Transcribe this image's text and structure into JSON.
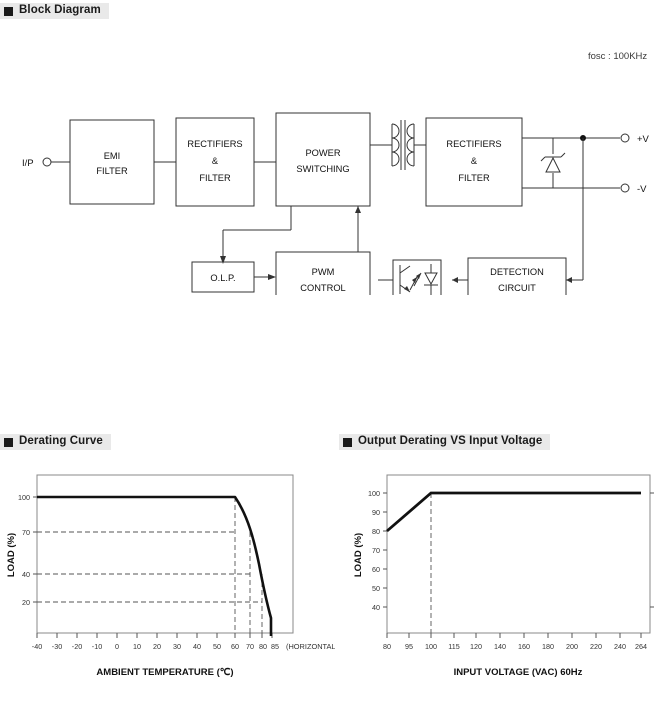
{
  "sections": {
    "block_diagram": {
      "title": "Block Diagram"
    },
    "derating_curve": {
      "title": "Derating Curve"
    },
    "output_derating": {
      "title": "Output Derating VS Input Voltage"
    }
  },
  "block_diagram": {
    "fosc_note": "fosc : 100KHz",
    "input_terminal": "I/P",
    "output_terminals": [
      "+V",
      "-V"
    ],
    "blocks": [
      {
        "id": "emi-filter",
        "lines": [
          "EMI",
          "FILTER"
        ]
      },
      {
        "id": "rectifiers-filter-primary",
        "lines": [
          "RECTIFIERS",
          "&",
          "FILTER"
        ]
      },
      {
        "id": "power-switching",
        "lines": [
          "POWER",
          "SWITCHING"
        ]
      },
      {
        "id": "rectifiers-filter-secondary",
        "lines": [
          "RECTIFIERS",
          "&",
          "FILTER"
        ]
      },
      {
        "id": "olp",
        "lines": [
          "O.L.P."
        ]
      },
      {
        "id": "pwm-control",
        "lines": [
          "PWM",
          "CONTROL"
        ]
      },
      {
        "id": "detection-circuit",
        "lines": [
          "DETECTION",
          "CIRCUIT"
        ]
      }
    ],
    "symbols": [
      "transformer",
      "optocoupler",
      "zener-diode"
    ]
  },
  "chart_data": [
    {
      "type": "line",
      "id": "derating-curve",
      "title": "Derating Curve",
      "xlabel": "AMBIENT TEMPERATURE (℃)",
      "ylabel": "LOAD (%)",
      "note": "(HORIZONTAL)",
      "x": [
        -40,
        60,
        70,
        80,
        85,
        85
      ],
      "values": [
        100,
        100,
        70,
        40,
        20,
        0
      ],
      "xticks": [
        -40,
        -30,
        -20,
        -10,
        0,
        10,
        20,
        30,
        40,
        50,
        60,
        70,
        80,
        85
      ],
      "xtick_labels": [
        "-40",
        "-30",
        "-20",
        "-10",
        "0",
        "10",
        "20",
        "30",
        "40",
        "50",
        "60",
        "70",
        "80",
        "85"
      ],
      "yticks": [
        20,
        40,
        70,
        100
      ],
      "ytick_labels": [
        "20",
        "40",
        "70",
        "100"
      ],
      "xlim": [
        -40,
        92
      ],
      "ylim": [
        0,
        112
      ],
      "guides_v": [
        60,
        70,
        80
      ],
      "guides_h": [
        20,
        40,
        70
      ],
      "grid": "dashed-guides",
      "legend": "none"
    },
    {
      "type": "line",
      "id": "output-derating-vs-input-voltage",
      "title": "Output Derating VS Input Voltage",
      "xlabel": "INPUT VOLTAGE (VAC) 60Hz",
      "ylabel": "LOAD (%)",
      "x": [
        80,
        100,
        264
      ],
      "values": [
        80,
        100,
        100
      ],
      "xticks": [
        80,
        95,
        100,
        115,
        120,
        140,
        160,
        180,
        200,
        220,
        240,
        264
      ],
      "xtick_labels": [
        "80",
        "95",
        "100",
        "115",
        "120",
        "140",
        "160",
        "180",
        "200",
        "220",
        "240",
        "264"
      ],
      "yticks": [
        40,
        50,
        60,
        70,
        80,
        90,
        100
      ],
      "ytick_labels": [
        "40",
        "50",
        "60",
        "70",
        "80",
        "90",
        "100"
      ],
      "xlim": [
        75,
        285
      ],
      "ylim": [
        30,
        108
      ],
      "guides_v": [
        100
      ],
      "guides_h": [],
      "grid": "dashed-guides",
      "legend": "none"
    }
  ]
}
